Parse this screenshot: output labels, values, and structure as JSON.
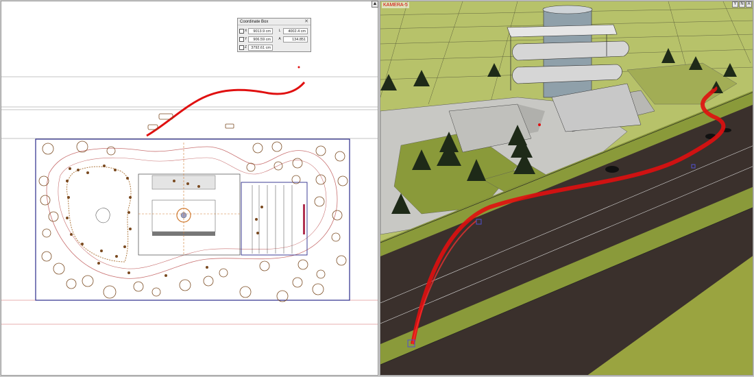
{
  "left_view": {
    "corner_button_glyph": "▲"
  },
  "coordinate_box": {
    "title": "Coordinate Box",
    "close_glyph": "✕",
    "x_label": "X",
    "x_value": "9013.9 cm",
    "y_label": "Y",
    "y_value": "906.59 cm",
    "z_label": "Z",
    "z_value": "3792.61 cm",
    "l_label": "L",
    "l_value": "4002.4 cm",
    "a_label": "A",
    "a_value": "134.851"
  },
  "camera_view": {
    "label": "KAMERA-5",
    "tools": [
      "Y",
      "N",
      "A"
    ]
  },
  "colors": {
    "path_red": "#e01010",
    "plan_border": "#2a2a8a",
    "tree_brown": "#7a4a20",
    "grass": "#8a9a3a",
    "road": "#3a302c"
  }
}
